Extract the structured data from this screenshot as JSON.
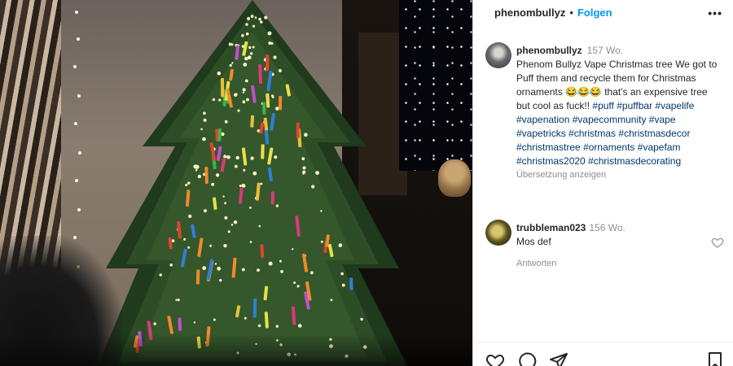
{
  "header": {
    "username": "phenombullyz",
    "separator": "•",
    "follow_label": "Folgen",
    "more_icon": "more-horizontal-icon"
  },
  "post": {
    "username": "phenombullyz",
    "age": "157 Wo.",
    "text": "Phenom Bullyz Vape Christmas tree We got to Puff them and recycle them for Christmas ornaments 😂😂😂 that's an expensive tree but cool as fuck!!",
    "hashtags": [
      "#puff",
      "#puffbar",
      "#vapelife",
      "#vapenation",
      "#vapecommunity",
      "#vape",
      "#vapetricks",
      "#christmas",
      "#christmasdecor",
      "#christmastree",
      "#ornaments",
      "#vapefam",
      "#christmas2020",
      "#christmasdecorating"
    ],
    "translate_label": "Übersetzung anzeigen"
  },
  "comment": {
    "username": "trubbleman023",
    "age": "156 Wo.",
    "text": "Mos def",
    "reply_label": "Antworten"
  },
  "action_icons": [
    "heart-icon",
    "comment-icon",
    "share-icon",
    "bookmark-icon"
  ],
  "colors": {
    "link_blue": "#0095f6",
    "hashtag": "#00376b",
    "meta_gray": "#8e8e8e",
    "text": "#262626"
  }
}
